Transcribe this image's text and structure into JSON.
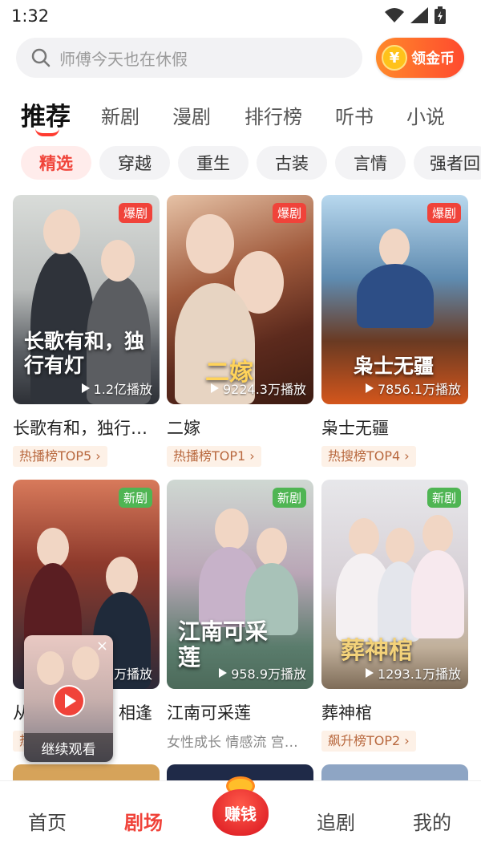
{
  "status": {
    "time": "1:32"
  },
  "search": {
    "placeholder": "师傅今天也在休假"
  },
  "coin_button": {
    "symbol": "¥",
    "label": "领金币"
  },
  "tabs": [
    {
      "label": "推荐",
      "active": true
    },
    {
      "label": "新剧"
    },
    {
      "label": "漫剧"
    },
    {
      "label": "排行榜"
    },
    {
      "label": "听书"
    },
    {
      "label": "小说"
    }
  ],
  "chips": [
    {
      "label": "精选",
      "active": true
    },
    {
      "label": "穿越"
    },
    {
      "label": "重生"
    },
    {
      "label": "古装"
    },
    {
      "label": "言情"
    },
    {
      "label": "强者回"
    }
  ],
  "cards": [
    {
      "title": "长歌有和，独行…",
      "poster_text": "长歌有和，独行有灯",
      "badge": "爆剧",
      "plays": "1.2亿播放",
      "rank": "热播榜TOP5"
    },
    {
      "title": "二嫁",
      "poster_text": "二嫁",
      "badge": "爆剧",
      "plays": "9224.3万播放",
      "rank": "热播榜TOP1"
    },
    {
      "title": "枭士无疆",
      "poster_text": "枭士无疆",
      "badge": "爆剧",
      "plays": "7856.1万播放",
      "rank": "热搜榜TOP4"
    },
    {
      "title": "从…",
      "title_tail": "相逢",
      "badge": "新剧",
      "plays": "万播放",
      "rank": "热"
    },
    {
      "title": "江南可采莲",
      "poster_text": "江南可采莲",
      "badge": "新剧",
      "plays": "958.9万播放",
      "tags": "女性成长 情感流 宫…"
    },
    {
      "title": "葬神棺",
      "poster_text": "葬神棺",
      "badge": "新剧",
      "plays": "1293.1万播放",
      "rank": "飙升榜TOP2"
    }
  ],
  "mini_player": {
    "close": "×",
    "label": "继续观看"
  },
  "nav": {
    "home": "首页",
    "theater": "剧场",
    "earn": "赚钱",
    "follow": "追剧",
    "mine": "我的"
  },
  "colors": {
    "accent": "#f0433a",
    "hot_badge": "#f0433a",
    "new_badge": "#4fb553",
    "rank_text": "#b8683e"
  }
}
